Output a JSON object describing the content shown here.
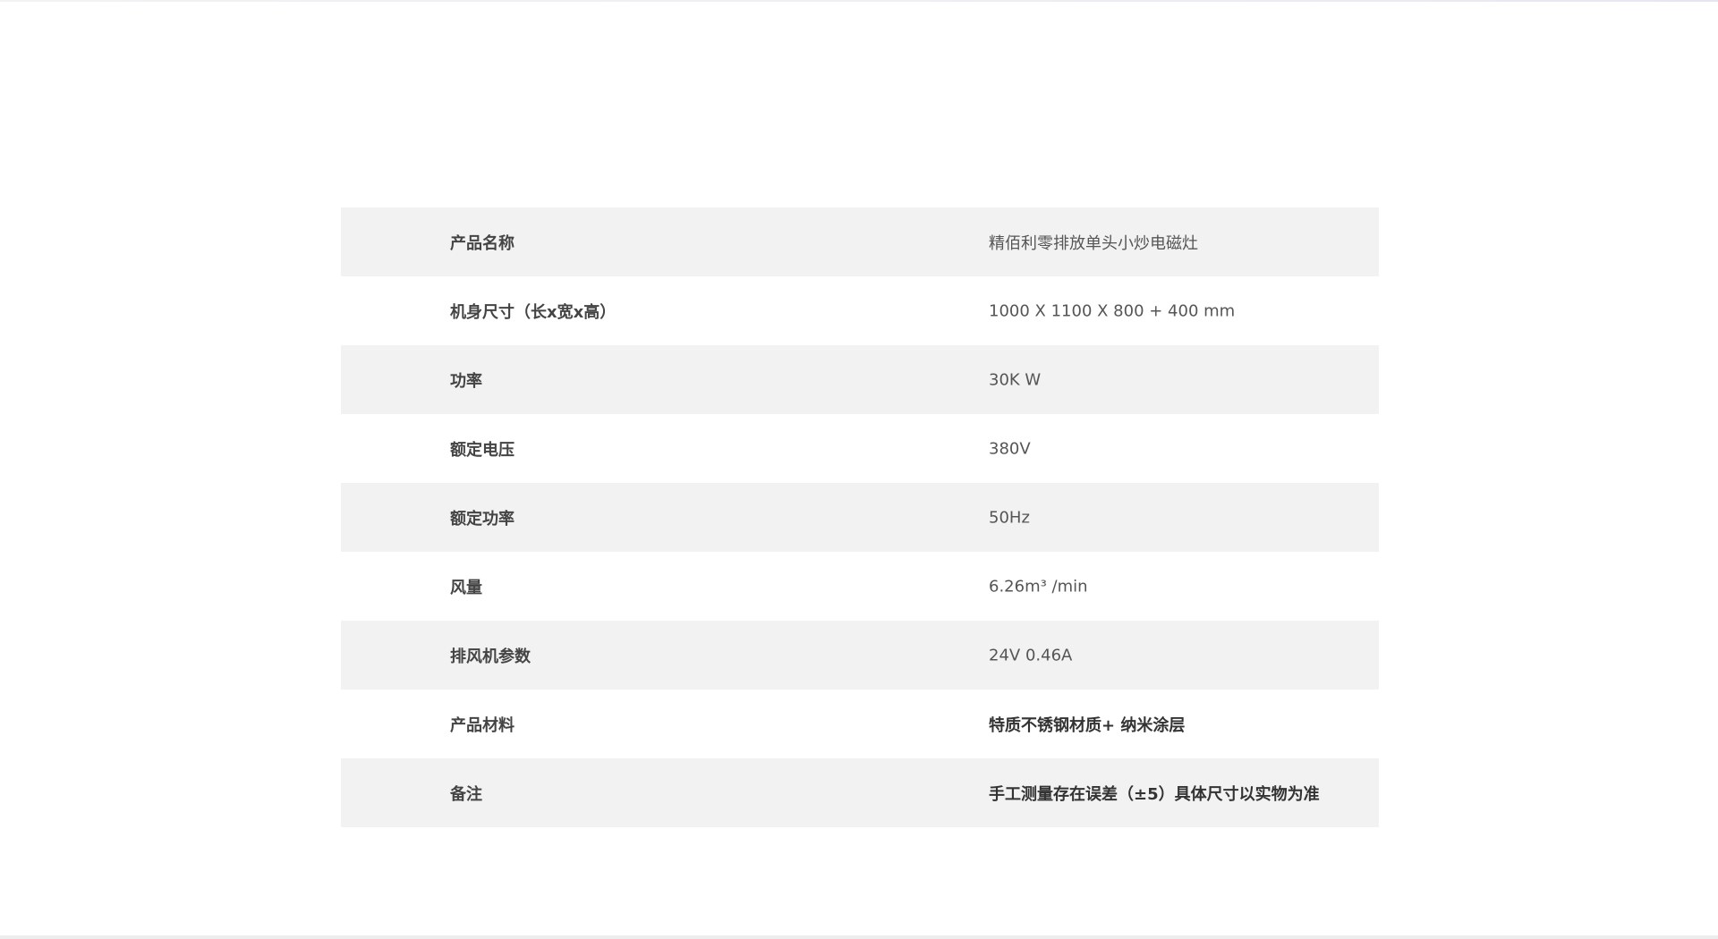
{
  "spec_table": {
    "rows": [
      {
        "label": "产品名称",
        "value": "精佰利零排放单头小炒电磁灶"
      },
      {
        "label": "机身尺寸（长x宽x高）",
        "value": "1000 X 1100 X 800 + 400 mm"
      },
      {
        "label": "功率",
        "value": "30K W"
      },
      {
        "label": "额定电压",
        "value": "380V"
      },
      {
        "label": "额定功率",
        "value": "50Hz"
      },
      {
        "label": "风量",
        "value": "6.26m³ /min"
      },
      {
        "label": "排风机参数",
        "value": "24V 0.46A"
      },
      {
        "label": "产品材料",
        "value": "特质不锈钢材质+ 纳米涂层"
      },
      {
        "label": "备注",
        "value": "手工测量存在误差（±5）具体尺寸以实物为准"
      }
    ]
  },
  "colors": {
    "row_shade": "#f2f2f2",
    "label_text": "#444444",
    "value_text": "#555555"
  }
}
